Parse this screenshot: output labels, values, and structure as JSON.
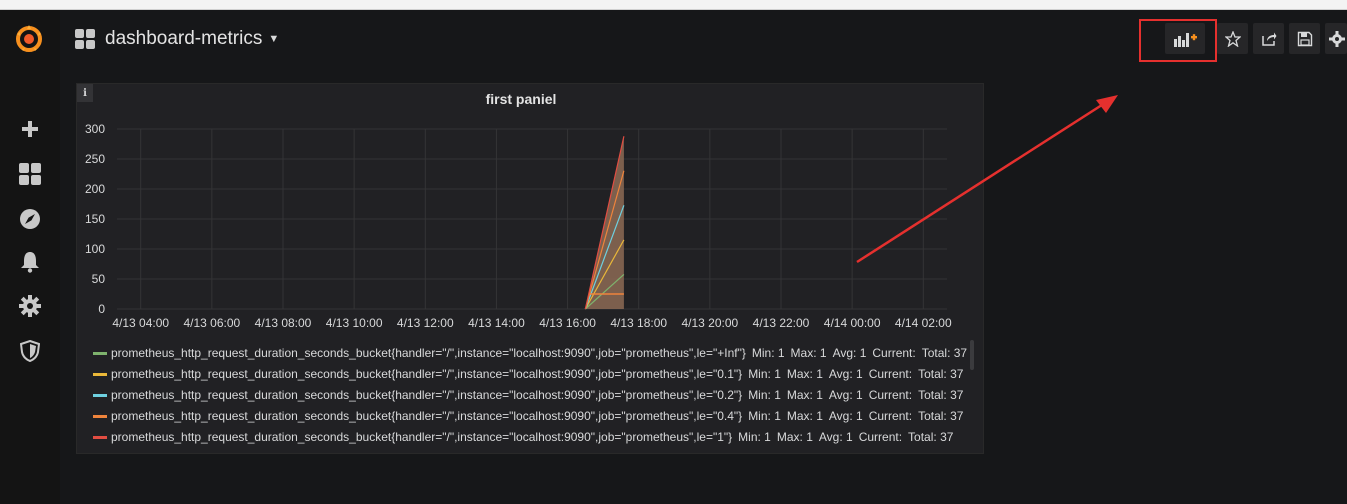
{
  "dashboard": {
    "title": "dashboard-metrics"
  },
  "panel": {
    "title": "first paniel",
    "info_label": "i"
  },
  "nav_icons": [
    "add-panel-icon",
    "star-icon",
    "share-icon",
    "save-icon",
    "settings-icon"
  ],
  "sidemenu_icons": [
    "grafana-logo-icon",
    "plus-icon",
    "dashboards-icon",
    "explore-compass-icon",
    "alerting-bell-icon",
    "configuration-gear-icon",
    "server-admin-shield-icon"
  ],
  "colors": {
    "sidebar_bg": "#141414",
    "main_bg": "#161719",
    "panel_bg": "#212124",
    "highlight": "#e5302e",
    "plot_fill": "#8c6a55"
  },
  "chart_data": {
    "type": "area",
    "title": "first paniel",
    "ylim": [
      0,
      300
    ],
    "yticks": [
      "0",
      "50",
      "100",
      "150",
      "200",
      "250",
      "300"
    ],
    "xticks": [
      "4/13 04:00",
      "4/13 06:00",
      "4/13 08:00",
      "4/13 10:00",
      "4/13 12:00",
      "4/13 14:00",
      "4/13 16:00",
      "4/13 18:00",
      "4/13 20:00",
      "4/13 22:00",
      "4/14 00:00",
      "4/14 02:00"
    ],
    "x": [
      "4/13 16:30",
      "4/13 17:35"
    ],
    "stacked_total": [
      0,
      288
    ],
    "series": [
      {
        "name": "prometheus_http_request_duration_seconds_bucket{handler=\"/\",instance=\"localhost:9090\",job=\"prometheus\",le=\"+Inf\"}",
        "color": "#7eb26d",
        "min": "Min: 1",
        "max": "Max: 1",
        "avg": "Avg: 1",
        "current": "Current:",
        "total": "Total: 37"
      },
      {
        "name": "prometheus_http_request_duration_seconds_bucket{handler=\"/\",instance=\"localhost:9090\",job=\"prometheus\",le=\"0.1\"}",
        "color": "#eab839",
        "min": "Min: 1",
        "max": "Max: 1",
        "avg": "Avg: 1",
        "current": "Current:",
        "total": "Total: 37"
      },
      {
        "name": "prometheus_http_request_duration_seconds_bucket{handler=\"/\",instance=\"localhost:9090\",job=\"prometheus\",le=\"0.2\"}",
        "color": "#6ed0e0",
        "min": "Min: 1",
        "max": "Max: 1",
        "avg": "Avg: 1",
        "current": "Current:",
        "total": "Total: 37"
      },
      {
        "name": "prometheus_http_request_duration_seconds_bucket{handler=\"/\",instance=\"localhost:9090\",job=\"prometheus\",le=\"0.4\"}",
        "color": "#ef843c",
        "min": "Min: 1",
        "max": "Max: 1",
        "avg": "Avg: 1",
        "current": "Current:",
        "total": "Total: 37"
      },
      {
        "name": "prometheus_http_request_duration_seconds_bucket{handler=\"/\",instance=\"localhost:9090\",job=\"prometheus\",le=\"1\"}",
        "color": "#e24d42",
        "min": "Min: 1",
        "max": "Max: 1",
        "avg": "Avg: 1",
        "current": "Current:",
        "total": "Total: 37"
      }
    ]
  }
}
